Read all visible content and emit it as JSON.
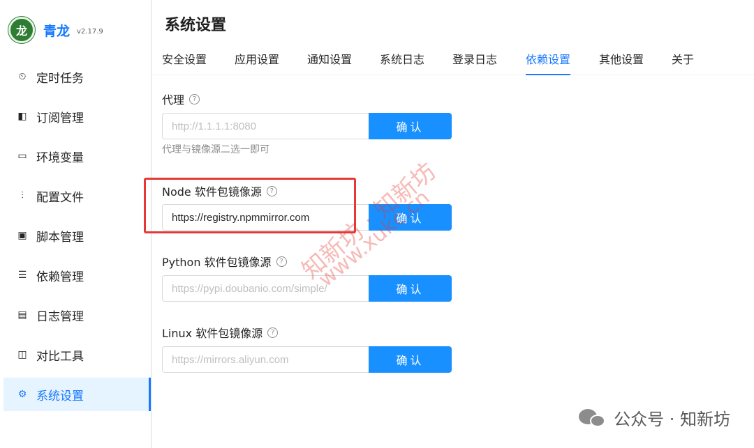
{
  "brand": {
    "name": "青龙",
    "version": "v2.17.9",
    "logo_icon": "dragon-logo-icon"
  },
  "sidebar": {
    "items": [
      {
        "label": "定时任务",
        "icon": "clock-icon",
        "glyph": "⏲"
      },
      {
        "label": "订阅管理",
        "icon": "subscription-icon",
        "glyph": "◧"
      },
      {
        "label": "环境变量",
        "icon": "monitor-icon",
        "glyph": "▭"
      },
      {
        "label": "配置文件",
        "icon": "sliders-icon",
        "glyph": "⫶"
      },
      {
        "label": "脚本管理",
        "icon": "terminal-icon",
        "glyph": "▣"
      },
      {
        "label": "依赖管理",
        "icon": "list-icon",
        "glyph": "☰"
      },
      {
        "label": "日志管理",
        "icon": "log-icon",
        "glyph": "▤"
      },
      {
        "label": "对比工具",
        "icon": "diff-icon",
        "glyph": "◫"
      },
      {
        "label": "系统设置",
        "icon": "gear-icon",
        "glyph": "⚙",
        "active": true
      }
    ]
  },
  "header": {
    "title": "系统设置"
  },
  "tabs": [
    {
      "label": "安全设置"
    },
    {
      "label": "应用设置"
    },
    {
      "label": "通知设置"
    },
    {
      "label": "系统日志"
    },
    {
      "label": "登录日志"
    },
    {
      "label": "依赖设置",
      "active": true
    },
    {
      "label": "其他设置"
    },
    {
      "label": "关于"
    }
  ],
  "form": {
    "proxy": {
      "label": "代理",
      "placeholder": "http://1.1.1.1:8080",
      "value": "",
      "button": "确认",
      "hint": "代理与镜像源二选一即可"
    },
    "node": {
      "label": "Node 软件包镜像源",
      "placeholder": "",
      "value": "https://registry.npmmirror.com",
      "button": "确认"
    },
    "python": {
      "label": "Python 软件包镜像源",
      "placeholder": "https://pypi.doubanio.com/simple/",
      "value": "",
      "button": "确认"
    },
    "linux": {
      "label": "Linux 软件包镜像源",
      "placeholder": "https://mirrors.aliyun.com",
      "value": "",
      "button": "确认"
    }
  },
  "watermark": {
    "line1": "知新坊 · 知新坊",
    "line2": "www.xukc.cn"
  },
  "footer": {
    "wechat_text": "公众号 · 知新坊"
  },
  "colors": {
    "accent": "#1677ff",
    "button": "#1890ff",
    "highlight": "#e53935"
  }
}
